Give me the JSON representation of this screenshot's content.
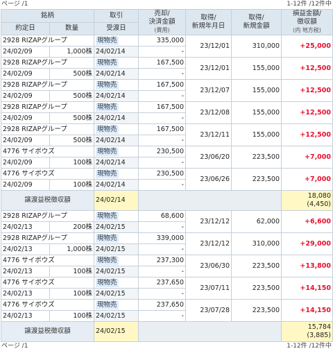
{
  "pager": {
    "page_label": "ページ /1",
    "range": "1-12件 /12件中"
  },
  "headers": {
    "stock": "銘柄",
    "trade": "取引",
    "sale_line1": "売却/",
    "sale_line2": "決済金額",
    "sale_note": "(費用)",
    "acq_line1": "取得/",
    "acq_line2": "新規年月日",
    "acq_amount_line1": "取得/",
    "acq_amount_line2": "新規金額",
    "pl_line1": "損益金額/",
    "pl_line2": "徴収額",
    "pl_note": "(内 地方税)",
    "contract_date": "約定日",
    "quantity": "数量",
    "delivery_date": "受渡日"
  },
  "groups": [
    {
      "trades": [
        {
          "name": "2928 RIZAPグループ",
          "contract": "24/02/09",
          "qty": "1,000株",
          "type": "現物売",
          "delivery": "24/02/14",
          "sale": "335,000",
          "cost": "-",
          "acq_date": "23/12/01",
          "acq_amount": "310,000",
          "pl": "+25,000"
        },
        {
          "name": "2928 RIZAPグループ",
          "contract": "24/02/09",
          "qty": "500株",
          "type": "現物売",
          "delivery": "24/02/14",
          "sale": "167,500",
          "cost": "-",
          "acq_date": "23/12/01",
          "acq_amount": "155,000",
          "pl": "+12,500"
        },
        {
          "name": "2928 RIZAPグループ",
          "contract": "24/02/09",
          "qty": "500株",
          "type": "現物売",
          "delivery": "24/02/14",
          "sale": "167,500",
          "cost": "-",
          "acq_date": "23/12/07",
          "acq_amount": "155,000",
          "pl": "+12,500"
        },
        {
          "name": "2928 RIZAPグループ",
          "contract": "24/02/09",
          "qty": "500株",
          "type": "現物売",
          "delivery": "24/02/14",
          "sale": "167,500",
          "cost": "-",
          "acq_date": "23/12/08",
          "acq_amount": "155,000",
          "pl": "+12,500"
        },
        {
          "name": "2928 RIZAPグループ",
          "contract": "24/02/09",
          "qty": "500株",
          "type": "現物売",
          "delivery": "24/02/14",
          "sale": "167,500",
          "cost": "-",
          "acq_date": "23/12/11",
          "acq_amount": "155,000",
          "pl": "+12,500"
        },
        {
          "name": "4776 サイボウズ",
          "contract": "24/02/09",
          "qty": "100株",
          "type": "現物売",
          "delivery": "24/02/14",
          "sale": "230,500",
          "cost": "-",
          "acq_date": "23/06/20",
          "acq_amount": "223,500",
          "pl": "+7,000"
        },
        {
          "name": "4776 サイボウズ",
          "contract": "24/02/09",
          "qty": "100株",
          "type": "現物売",
          "delivery": "24/02/14",
          "sale": "230,500",
          "cost": "-",
          "acq_date": "23/06/26",
          "acq_amount": "223,500",
          "pl": "+7,000"
        }
      ],
      "tax": {
        "label": "譲渡益税徴収額",
        "date": "24/02/14",
        "amount": "18,080",
        "local": "(4,450)"
      }
    },
    {
      "trades": [
        {
          "name": "2928 RIZAPグループ",
          "contract": "24/02/13",
          "qty": "200株",
          "type": "現物売",
          "delivery": "24/02/15",
          "sale": "68,600",
          "cost": "-",
          "acq_date": "23/12/12",
          "acq_amount": "62,000",
          "pl": "+6,600"
        },
        {
          "name": "2928 RIZAPグループ",
          "contract": "24/02/13",
          "qty": "1,000株",
          "type": "現物売",
          "delivery": "24/02/15",
          "sale": "339,000",
          "cost": "-",
          "acq_date": "23/12/12",
          "acq_amount": "310,000",
          "pl": "+29,000"
        },
        {
          "name": "4776 サイボウズ",
          "contract": "24/02/13",
          "qty": "100株",
          "type": "現物売",
          "delivery": "24/02/15",
          "sale": "237,300",
          "cost": "-",
          "acq_date": "23/06/30",
          "acq_amount": "223,500",
          "pl": "+13,800"
        },
        {
          "name": "4776 サイボウズ",
          "contract": "24/02/13",
          "qty": "100株",
          "type": "現物売",
          "delivery": "24/02/15",
          "sale": "237,650",
          "cost": "-",
          "acq_date": "23/07/11",
          "acq_amount": "223,500",
          "pl": "+14,150"
        },
        {
          "name": "4776 サイボウズ",
          "contract": "24/02/13",
          "qty": "100株",
          "type": "現物売",
          "delivery": "24/02/15",
          "sale": "237,650",
          "cost": "-",
          "acq_date": "23/07/28",
          "acq_amount": "223,500",
          "pl": "+14,150"
        }
      ],
      "tax": {
        "label": "譲渡益税徴収額",
        "date": "24/02/15",
        "amount": "15,784",
        "local": "(3,885)"
      }
    }
  ],
  "colors": {
    "gain": "#e8112d",
    "header_bg": "#dde7f0",
    "tax_bg": "#fff8c4"
  }
}
